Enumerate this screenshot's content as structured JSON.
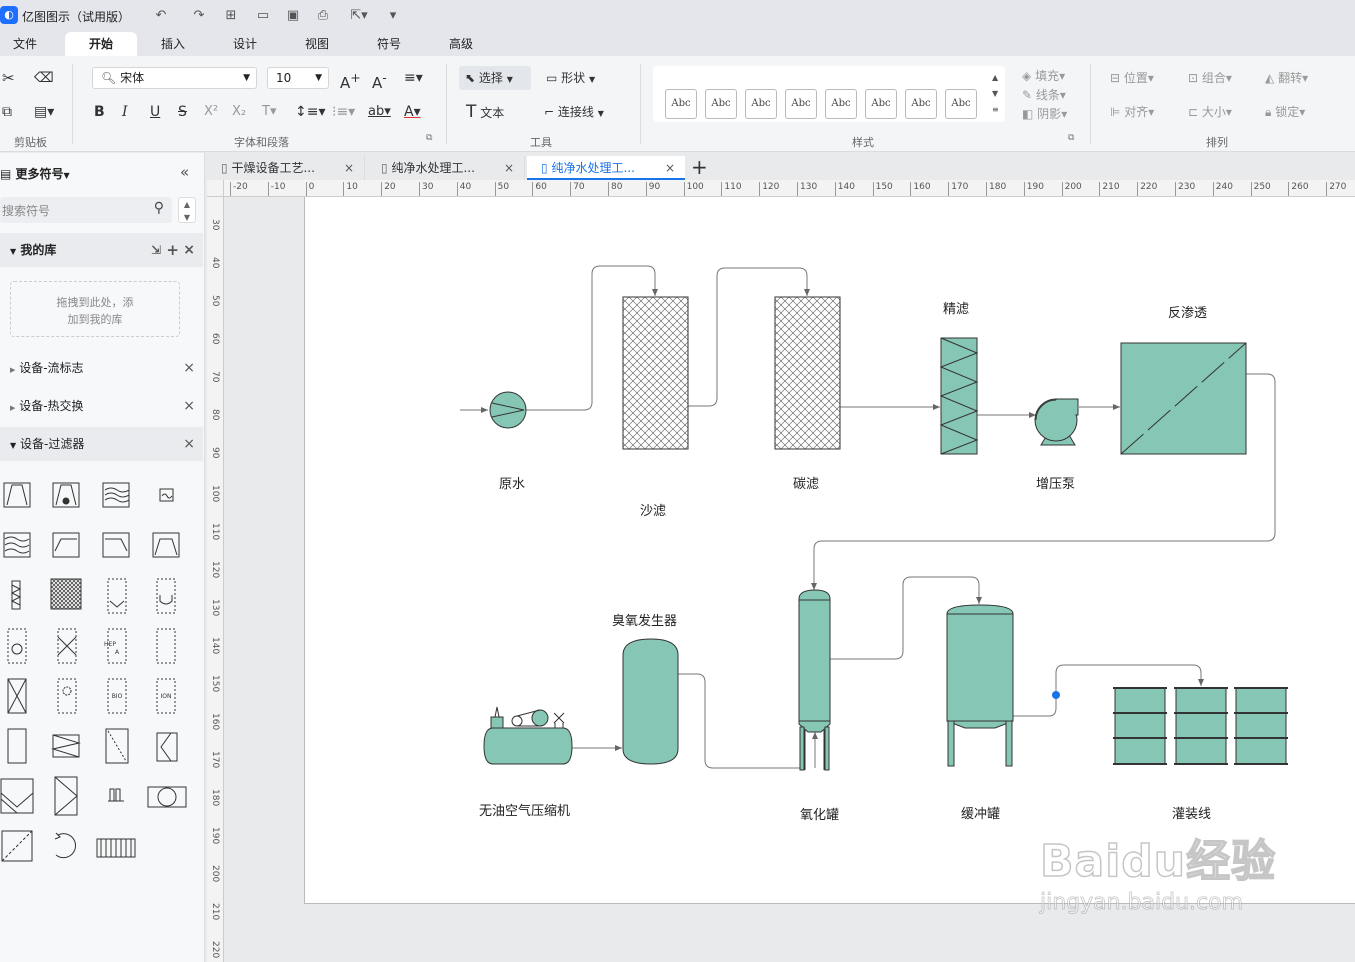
{
  "app": {
    "title": "亿图图示（试用版）"
  },
  "menu": [
    "文件",
    "开始",
    "插入",
    "设计",
    "视图",
    "符号",
    "高级"
  ],
  "ribbon": {
    "font_name": "宋体",
    "font_size": "10",
    "select_label": "选择",
    "shape_label": "形状",
    "text_label": "文本",
    "connector_label": "连接线",
    "style_sample": "Abc",
    "fill_label": "填充",
    "line_label": "线条",
    "shadow_label": "阴影",
    "position_label": "位置",
    "group_label": "组合",
    "flip_label": "翻转",
    "align_label": "对齐",
    "size_label": "大小",
    "lock_label": "锁定",
    "groups": {
      "clipboard": "剪贴板",
      "font": "字体和段落",
      "tools": "工具",
      "style": "样式",
      "arrange": "排列"
    }
  },
  "sidebar": {
    "title": "更多符号",
    "search_placeholder": "搜索符号",
    "my_library": "我的库",
    "drop_hint_1": "拖拽到此处，添",
    "drop_hint_2": "加到我的库",
    "sections": [
      "设备-流标志",
      "设备-热交换",
      "设备-过滤器"
    ]
  },
  "tabs": [
    "干燥设备工艺...",
    "纯净水处理工...",
    "纯净水处理工..."
  ],
  "ruler": {
    "h": [
      "-20",
      "-10",
      "0",
      "10",
      "20",
      "30",
      "40",
      "50",
      "60",
      "70",
      "80",
      "90",
      "100",
      "110",
      "120",
      "130",
      "140",
      "150",
      "160",
      "170",
      "180",
      "190",
      "200",
      "210",
      "220",
      "230",
      "240",
      "250",
      "260",
      "270"
    ],
    "v": [
      "30",
      "40",
      "50",
      "60",
      "70",
      "80",
      "90",
      "100",
      "110",
      "120",
      "130",
      "140",
      "150",
      "160",
      "170",
      "180",
      "190",
      "200",
      "210",
      "220"
    ]
  },
  "diagram": {
    "labels": {
      "raw_water": "原水",
      "sand_filter": "沙滤",
      "carbon_filter": "碳滤",
      "fine_filter": "精滤",
      "booster_pump": "增压泵",
      "reverse_osmosis": "反渗透",
      "ozone_generator": "臭氧发生器",
      "air_compressor": "无油空气压缩机",
      "oxidation_tank": "氧化罐",
      "buffer_tank": "缓冲罐",
      "filling_line": "灌装线"
    },
    "fill_color": "#86c6b5",
    "symbol_text": {
      "hepa": "HEP\nA",
      "bio": "BIO",
      "ion": "ION"
    }
  },
  "watermark": {
    "text": "Baidu经验",
    "url": "jingyan.baidu.com"
  }
}
